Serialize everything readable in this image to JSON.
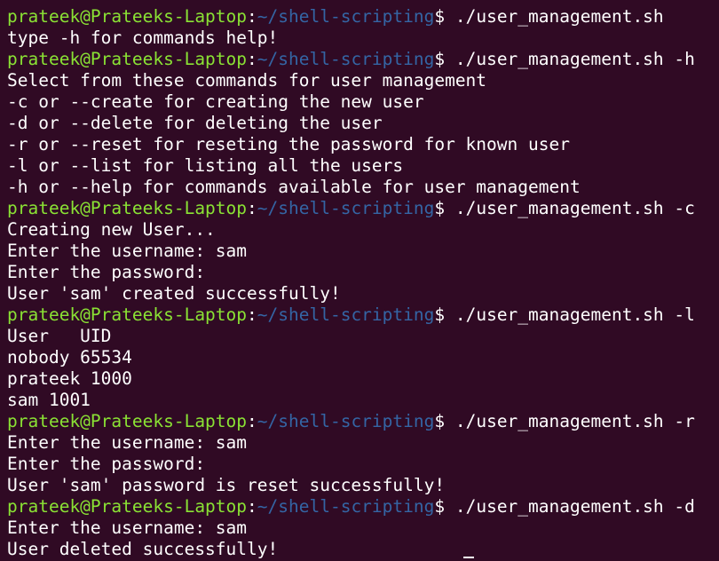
{
  "colors": {
    "background": "#300a24",
    "prompt_user": "#8ae234",
    "prompt_path": "#3465a4",
    "text": "#ffffff"
  },
  "prompt": {
    "user_host": "prateek@Prateeks-Laptop",
    "colon": ":",
    "path": "~/shell-scripting",
    "dollar": "$ "
  },
  "lines": [
    {
      "type": "prompt",
      "command": "./user_management.sh"
    },
    {
      "type": "output",
      "text": "type -h for commands help!"
    },
    {
      "type": "prompt",
      "command": "./user_management.sh -h"
    },
    {
      "type": "output",
      "text": "Select from these commands for user management"
    },
    {
      "type": "output",
      "text": "-c or --create for creating the new user"
    },
    {
      "type": "output",
      "text": "-d or --delete for deleting the user"
    },
    {
      "type": "output",
      "text": "-r or --reset for reseting the password for known user"
    },
    {
      "type": "output",
      "text": "-l or --list for listing all the users"
    },
    {
      "type": "output",
      "text": "-h or --help for commands available for user management"
    },
    {
      "type": "prompt",
      "command": "./user_management.sh -c"
    },
    {
      "type": "output",
      "text": "Creating new User..."
    },
    {
      "type": "output",
      "text": "Enter the username: sam"
    },
    {
      "type": "output",
      "text": "Enter the password:"
    },
    {
      "type": "output",
      "text": "User 'sam' created successfully!"
    },
    {
      "type": "prompt",
      "command": "./user_management.sh -l"
    },
    {
      "type": "output",
      "text": "User   UID"
    },
    {
      "type": "output",
      "text": "nobody 65534"
    },
    {
      "type": "output",
      "text": "prateek 1000"
    },
    {
      "type": "output",
      "text": "sam 1001"
    },
    {
      "type": "prompt",
      "command": "./user_management.sh -r"
    },
    {
      "type": "output",
      "text": "Enter the username: sam"
    },
    {
      "type": "output",
      "text": "Enter the password:"
    },
    {
      "type": "output",
      "text": "User 'sam' password is reset successfully!"
    },
    {
      "type": "prompt",
      "command": "./user_management.sh -d"
    },
    {
      "type": "output",
      "text": "Enter the username: sam"
    },
    {
      "type": "output",
      "text": "User deleted successfully!"
    }
  ]
}
